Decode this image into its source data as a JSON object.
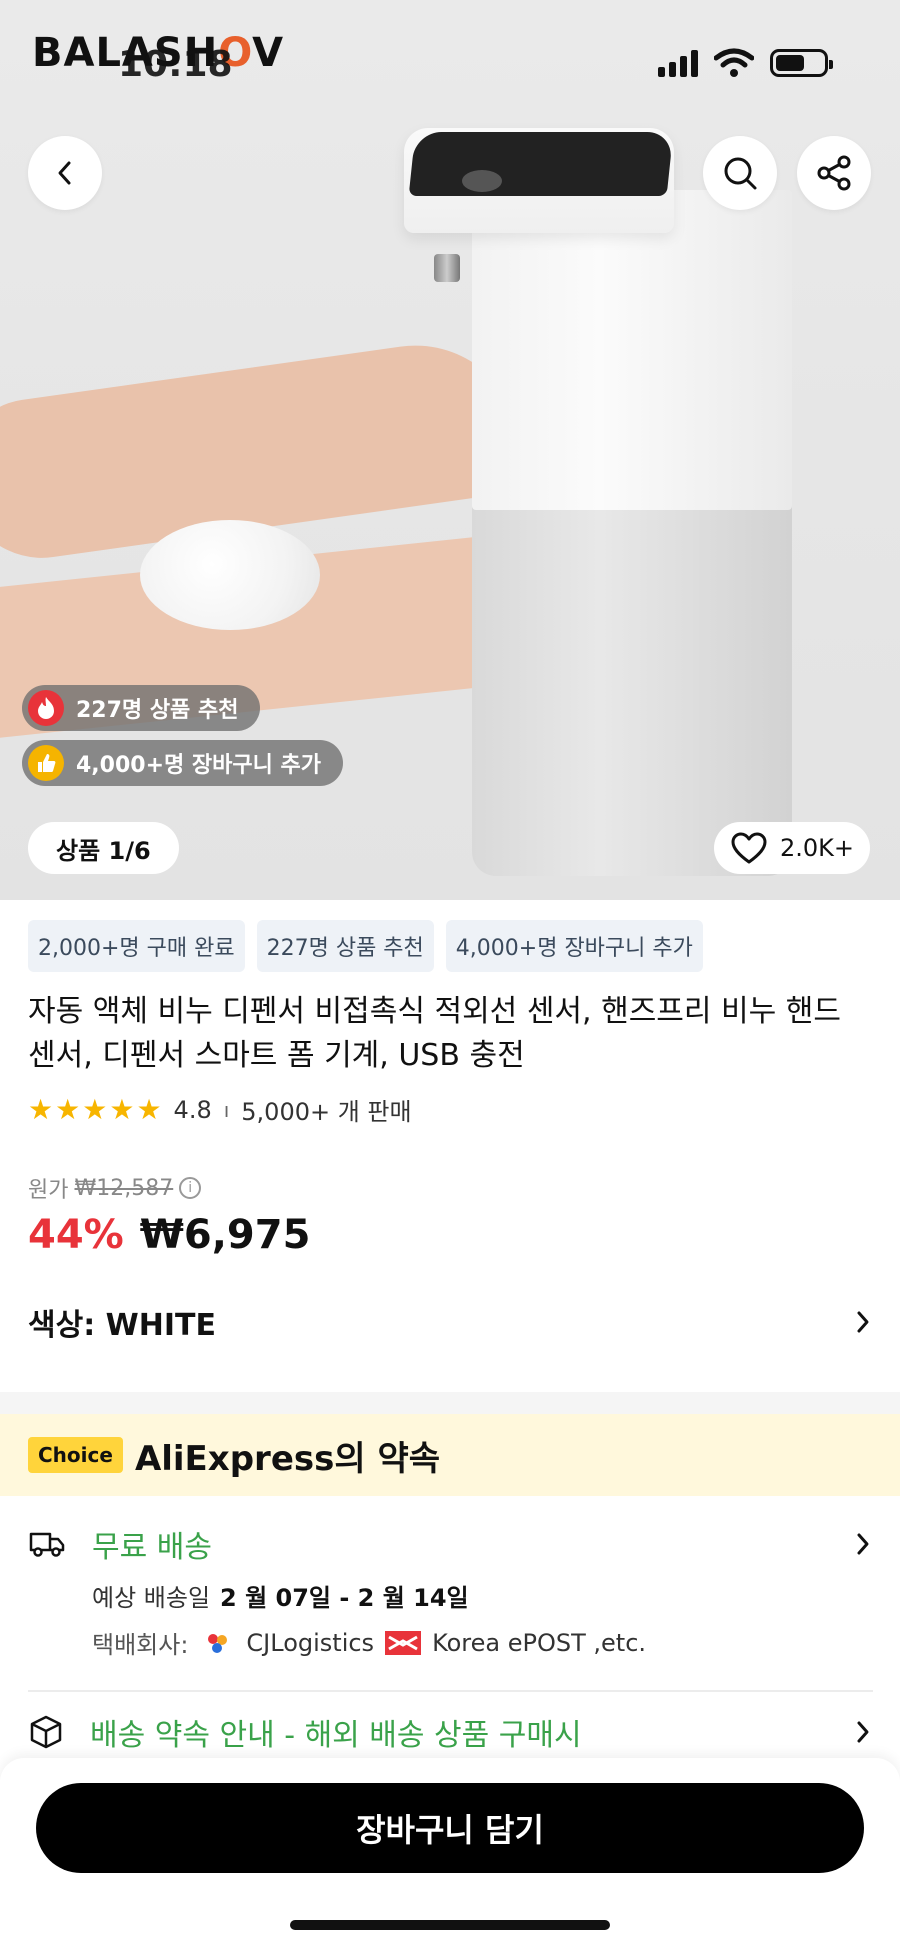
{
  "status_bar": {
    "brand": "BALASHOV",
    "time": "10:18"
  },
  "hero": {
    "recommend_pill": "227명 상품 추천",
    "cart_pill": "4,000+명 장바구니 추가",
    "image_counter": "상품 1/6",
    "wishlist_count": "2.0K+"
  },
  "tags": [
    "2,000+명 구매 완료",
    "227명 상품 추천",
    "4,000+명 장바구니 추가"
  ],
  "product": {
    "title": "자동 액체 비누 디펜서 비접촉식 적외선 센서, 핸즈프리 비누 핸드 센서, 디펜서 스마트 폼 기계, USB 충전",
    "rating": "4.8",
    "rating_value": 4.8,
    "rating_separator": "ı",
    "sold": "5,000+ 개 판매",
    "original_label": "원가",
    "original_price": "₩12,587",
    "discount": "44%",
    "price": "₩6,975",
    "color_label": "색상: WHITE"
  },
  "choice": {
    "badge": "Choice",
    "title": "AliExpress의 약속"
  },
  "shipping": {
    "title": "무료 배송",
    "eta_label": "예상 배송일",
    "eta_value": "2 월 07일 - 2 월 14일",
    "carrier_label": "택배회사:",
    "carrier1": "CJLogistics",
    "carrier2": "Korea ePOST ,etc."
  },
  "promise": {
    "title": "배송 약속 안내 - 해외 배송 상품 구매시"
  },
  "bottom": {
    "cart_button": "장바구니 담기"
  },
  "colors": {
    "accent_red": "#e8333a",
    "green": "#3aa24a",
    "choice_yellow": "#ffd43b",
    "banner_bg": "#fff8dc",
    "star": "#f7b500"
  },
  "icons": {
    "back": "chevron-left-icon",
    "search": "search-icon",
    "share": "share-icon",
    "fire": "fire-icon",
    "thumbs_up": "thumbs-up-icon",
    "heart": "heart-icon",
    "truck": "truck-icon",
    "box": "box-icon",
    "chevron": "chevron-right-icon",
    "info": "info-icon"
  }
}
